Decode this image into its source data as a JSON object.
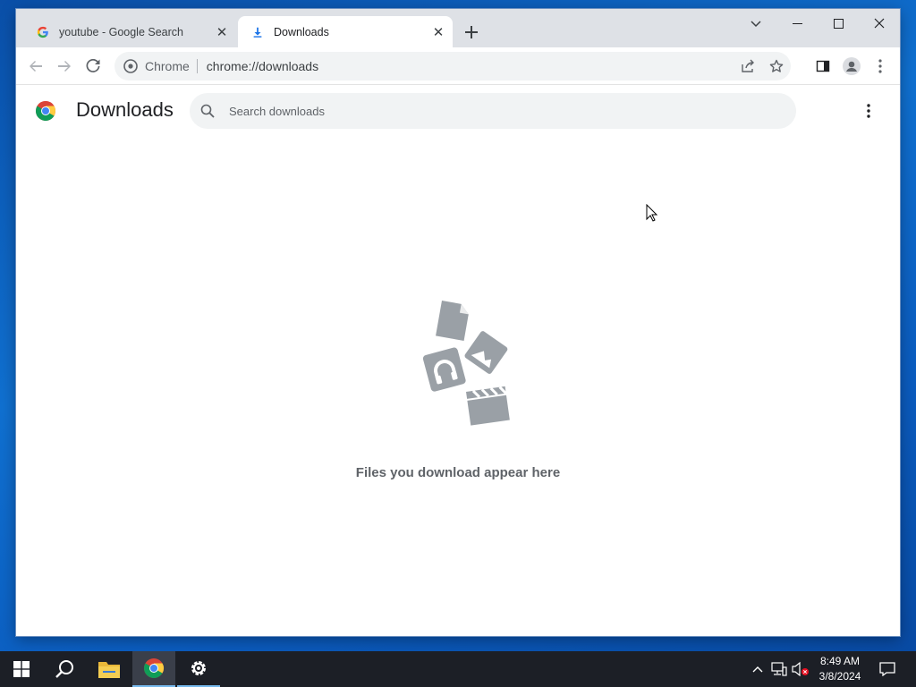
{
  "browser": {
    "tabs": [
      {
        "title": "youtube - Google Search",
        "favicon": "google-g-icon",
        "active": false
      },
      {
        "title": "Downloads",
        "favicon": "download-icon",
        "active": true
      }
    ],
    "omnibox": {
      "chip": "Chrome",
      "url": "chrome://downloads"
    }
  },
  "downloads_page": {
    "title": "Downloads",
    "search_placeholder": "Search downloads",
    "empty_message": "Files you download appear here"
  },
  "taskbar": {
    "time": "8:49 AM",
    "date": "3/8/2024"
  },
  "colors": {
    "tabstrip_bg": "#dee1e6",
    "omnibox_bg": "#f1f3f4",
    "illustration_gray": "#9aa0a6",
    "desktop_blue": "#0b5cbf",
    "taskbar_bg": "#1c1f26"
  }
}
